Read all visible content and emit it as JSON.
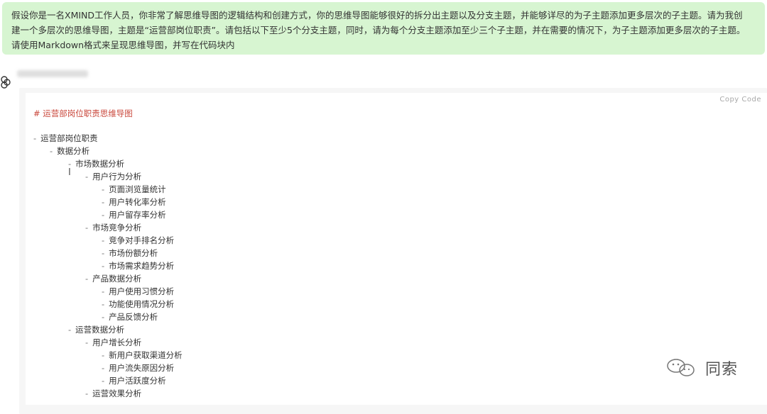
{
  "user_message": {
    "line1": "假设你是一名XMIND工作人员，你非常了解思维导图的逻辑结构和创建方式，你的思维导图能够很好的拆分出主题以及分支主题，并能够详尽的为子主题添加更多层次的子主题。请为我创",
    "line2": "建一个多层次的思维导图，主题是“运营部岗位职责”。请包括以下至少5个分支主题，同时，请为每个分支主题添加至少三个子主题，并在需要的情况下，为子主题添加更多层次的子主题。",
    "line3": "请使用Markdown格式来呈现思维导图，并写在代码块内"
  },
  "code_block": {
    "copy_label": "Copy Code",
    "heading": "# 运营部岗位职责思维导图",
    "tree": [
      {
        "text": "运营部岗位职责",
        "level": 0
      },
      {
        "text": "数据分析",
        "level": 1
      },
      {
        "text": "市场数据分析",
        "level": 2
      },
      {
        "text": "用户行为分析",
        "level": 3
      },
      {
        "text": "页面浏览量统计",
        "level": 4
      },
      {
        "text": "用户转化率分析",
        "level": 4
      },
      {
        "text": "用户留存率分析",
        "level": 4
      },
      {
        "text": "市场竞争分析",
        "level": 3
      },
      {
        "text": "竞争对手排名分析",
        "level": 4
      },
      {
        "text": "市场份额分析",
        "level": 4
      },
      {
        "text": "市场需求趋势分析",
        "level": 4
      },
      {
        "text": "产品数据分析",
        "level": 3
      },
      {
        "text": "用户使用习惯分析",
        "level": 4
      },
      {
        "text": "功能使用情况分析",
        "level": 4
      },
      {
        "text": "产品反馈分析",
        "level": 4
      },
      {
        "text": "运营数据分析",
        "level": 2
      },
      {
        "text": "用户增长分析",
        "level": 3
      },
      {
        "text": "新用户获取渠道分析",
        "level": 4
      },
      {
        "text": "用户流失原因分析",
        "level": 4
      },
      {
        "text": "用户活跃度分析",
        "level": 4
      },
      {
        "text": "运营效果分析",
        "level": 3
      }
    ]
  },
  "watermark": {
    "text": "同索"
  },
  "colors": {
    "user_bg": "#d7f5d1",
    "heading": "#c9473b"
  }
}
